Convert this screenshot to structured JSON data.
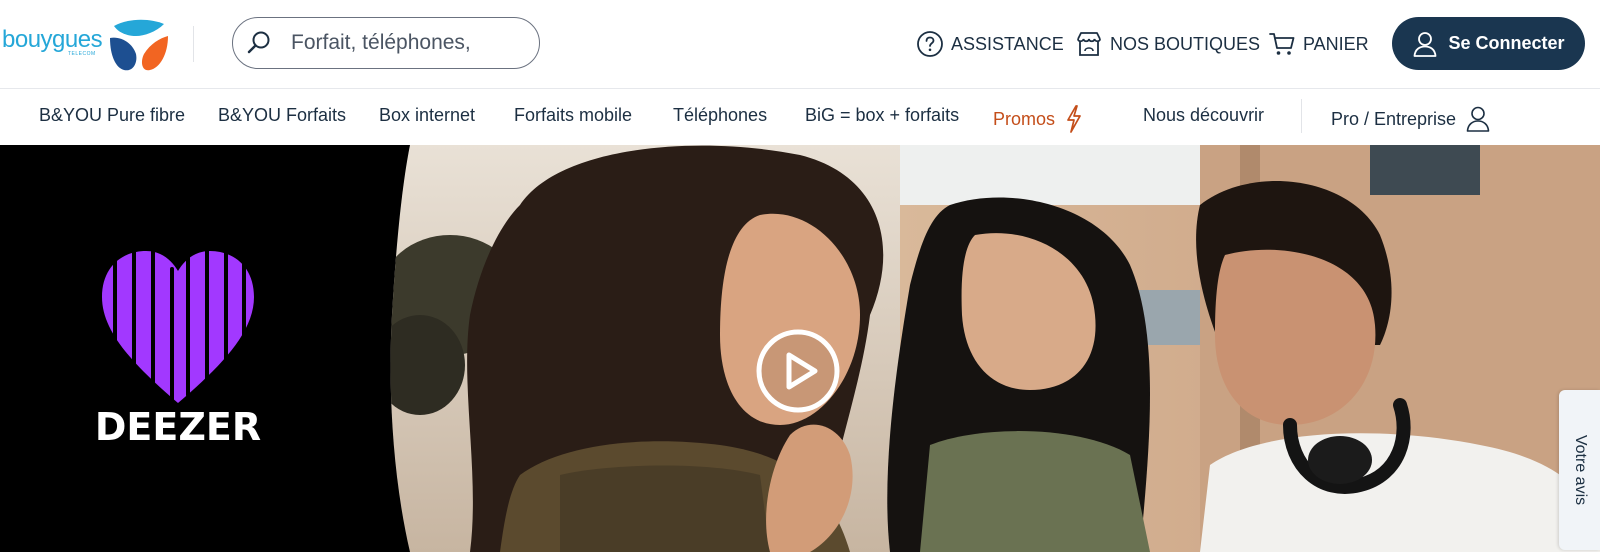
{
  "brand": {
    "logo_text": "bouygues",
    "logo_subtext": "TELECOM",
    "colors": {
      "primary": "#1a3650",
      "logo_blue": "#25a7d8",
      "logo_dark_blue": "#1d4f91",
      "logo_orange": "#f26522",
      "promo": "#c44e1a"
    }
  },
  "search": {
    "placeholder": "Forfait, téléphones,",
    "icon": "search-icon"
  },
  "header_links": [
    {
      "label": "ASSISTANCE",
      "icon": "help-circle-icon"
    },
    {
      "label": "NOS BOUTIQUES",
      "icon": "store-icon"
    },
    {
      "label": "PANIER",
      "icon": "cart-icon"
    }
  ],
  "login": {
    "label": "Se Connecter",
    "icon": "user-icon"
  },
  "nav": {
    "items": [
      {
        "label": "B&YOU Pure fibre"
      },
      {
        "label": "B&YOU Forfaits"
      },
      {
        "label": "Box internet"
      },
      {
        "label": "Forfaits mobile"
      },
      {
        "label": "Téléphones"
      },
      {
        "label": "BiG = box + forfaits"
      },
      {
        "label": "Promos",
        "icon": "lightning-icon"
      },
      {
        "label": "Nous découvrir"
      },
      {
        "label": "Pro / Entreprise",
        "icon": "user-icon"
      }
    ]
  },
  "hero": {
    "partner_logo_text": "DEEZER",
    "partner_color": "#a238ff",
    "play_icon": "play-icon"
  },
  "feedback": {
    "label": "Votre avis"
  }
}
